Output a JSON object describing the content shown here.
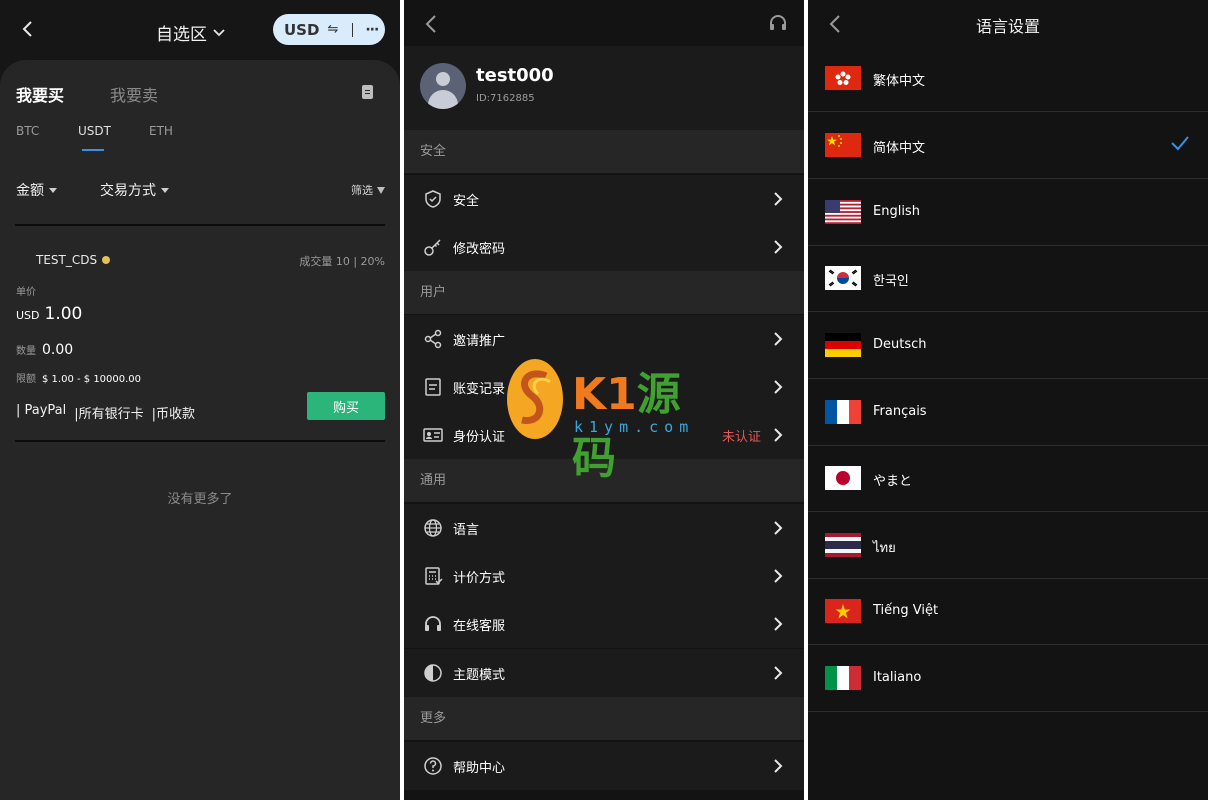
{
  "panel1": {
    "title": "自选区",
    "currency": "USD",
    "swap_glyph": "⇋",
    "more_glyph": "···",
    "tabs": {
      "buy": "我要买",
      "sell": "我要卖"
    },
    "coins": [
      "BTC",
      "USDT",
      "ETH"
    ],
    "active_coin": "USDT",
    "filters": {
      "amount": "金额",
      "method": "交易方式",
      "filter": "筛选"
    },
    "ad": {
      "trader": "TEST_CDS",
      "stats": "成交量 10 | 20%",
      "price_label": "单价",
      "price_currency": "USD",
      "price": "1.00",
      "qty_label": "数量",
      "qty": "0.00",
      "limit_label": "限额",
      "limit": "$ 1.00 - $ 10000.00",
      "methods": [
        "| PayPal",
        "|所有银行卡",
        "|币收款"
      ],
      "buy_button": "购买"
    },
    "no_more": "没有更多了"
  },
  "panel2": {
    "user": {
      "name": "test000",
      "id": "ID:7162885"
    },
    "sections": [
      {
        "title": "安全",
        "items": [
          {
            "label": "安全",
            "icon": "shield-icon"
          },
          {
            "label": "修改密码",
            "icon": "key-icon"
          }
        ]
      },
      {
        "title": "用户",
        "items": [
          {
            "label": "邀请推广",
            "icon": "share-icon"
          },
          {
            "label": "账变记录",
            "icon": "document-icon"
          },
          {
            "label": "身份认证",
            "icon": "id-card-icon",
            "status": "未认证"
          }
        ]
      },
      {
        "title": "通用",
        "items": [
          {
            "label": "语言",
            "icon": "globe-icon"
          },
          {
            "label": "计价方式",
            "icon": "calculator-icon"
          },
          {
            "label": "在线客服",
            "icon": "headset-icon"
          },
          {
            "label": "主题模式",
            "icon": "theme-icon"
          }
        ]
      },
      {
        "title": "更多",
        "items": [
          {
            "label": "帮助中心",
            "icon": "help-icon"
          }
        ]
      }
    ]
  },
  "panel3": {
    "title": "语言设置",
    "selected": "简体中文",
    "languages": [
      {
        "name": "繁体中文",
        "flag": "hongkong-flag-icon"
      },
      {
        "name": "简体中文",
        "flag": "china-flag-icon"
      },
      {
        "name": "English",
        "flag": "usa-flag-icon"
      },
      {
        "name": "한국인",
        "flag": "korea-flag-icon"
      },
      {
        "name": "Deutsch",
        "flag": "germany-flag-icon"
      },
      {
        "name": "Français",
        "flag": "france-flag-icon"
      },
      {
        "name": "やまと",
        "flag": "japan-flag-icon"
      },
      {
        "name": "ไทย",
        "flag": "thailand-flag-icon"
      },
      {
        "name": "Tiếng Việt",
        "flag": "vietnam-flag-icon"
      },
      {
        "name": "Italiano",
        "flag": "italy-flag-icon"
      }
    ]
  },
  "watermark": {
    "brand_a": "K1",
    "brand_b": "源码",
    "url": "k1ym.com"
  },
  "colors": {
    "accent_blue": "#3b8fe0",
    "buy_green": "#2bb57a",
    "warn_red": "#e05858"
  }
}
